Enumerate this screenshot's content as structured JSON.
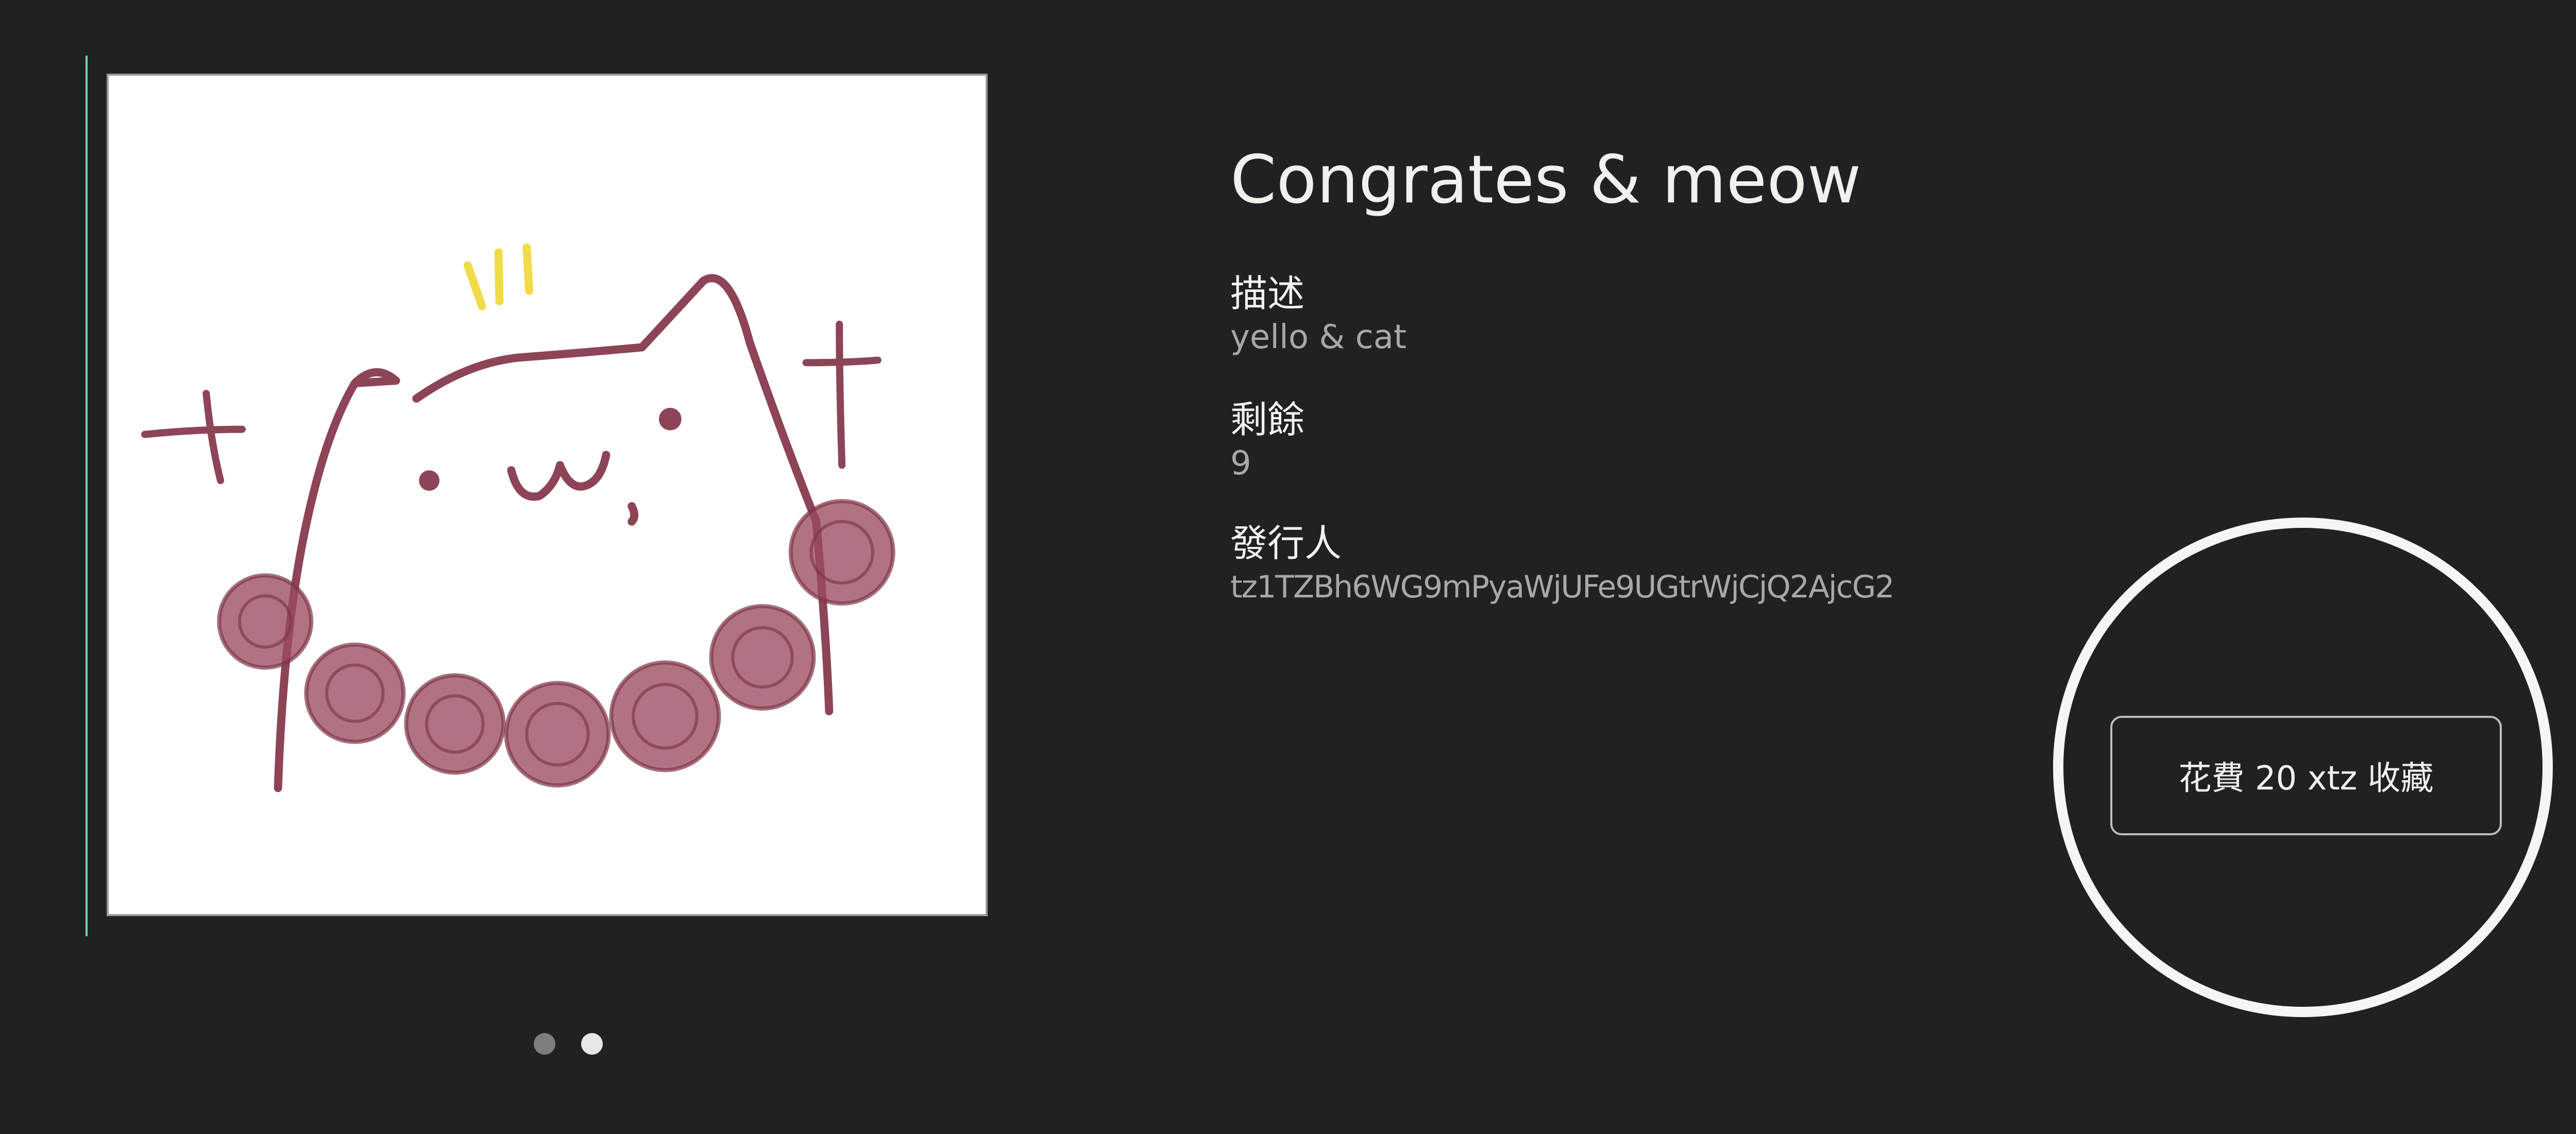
{
  "artwork": {
    "image": "cat-drawing-with-lollipops",
    "colors": {
      "line": "#8e4457",
      "fill": "#9b4a60",
      "accent": "#f0dc4a"
    }
  },
  "carousel": {
    "dots": 2,
    "active_index": 1
  },
  "token": {
    "title": "Congrates & meow",
    "fields": {
      "description": {
        "label": "描述",
        "value": "yello & cat"
      },
      "remaining": {
        "label": "剩餘",
        "value": "9"
      },
      "issuer": {
        "label": "發行人",
        "value": "tz1TZBh6WG9mPyaWjUFe9UGtrWjCjQ2AjcG2"
      }
    }
  },
  "action": {
    "collect_label": "花費 20 xtz 收藏"
  },
  "theme": {
    "background": "#202124",
    "accent_line": "#7ad0a4",
    "highlight_ring": "#f5f5f5"
  }
}
